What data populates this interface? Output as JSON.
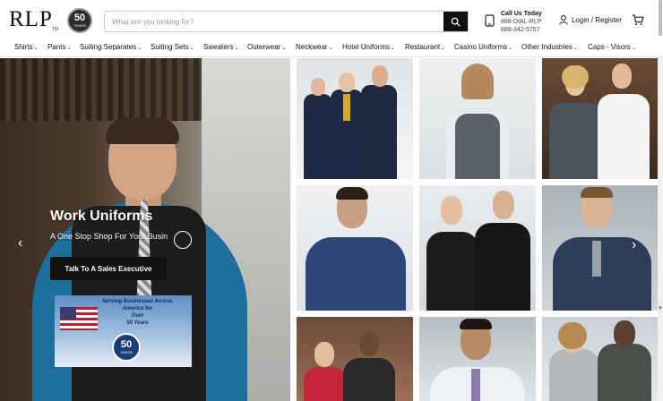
{
  "header": {
    "logo_text": "RLP",
    "logo_tm": "TM",
    "badge": {
      "number": "50",
      "sub": "YEARS"
    },
    "search": {
      "placeholder": "What are you looking for?",
      "value": ""
    },
    "call": {
      "title": "Call Us Today",
      "line1": "888-DIAL-RLP",
      "line2": "888-342-5757"
    },
    "login_label": "Login / Register",
    "icons": {
      "search": "search-icon",
      "phone": "phone-icon",
      "user": "user-icon",
      "cart": "cart-icon"
    }
  },
  "nav": {
    "items": [
      {
        "label": "Shirts"
      },
      {
        "label": "Pants"
      },
      {
        "label": "Suiting Separates"
      },
      {
        "label": "Suiting Sets"
      },
      {
        "label": "Sweaters"
      },
      {
        "label": "Outerwear"
      },
      {
        "label": "Neckwear"
      },
      {
        "label": "Hotel Uniforms"
      },
      {
        "label": "Restaurant"
      },
      {
        "label": "Casino Uniforms"
      },
      {
        "label": "Other Industries"
      },
      {
        "label": "Caps - Visors"
      }
    ]
  },
  "hero": {
    "title": "Work Uniforms",
    "subtitle": "A One Stop Shop For Your Busin",
    "button_label": "Talk To A Sales Executive",
    "prev_label": "‹",
    "next_label": "›",
    "promo": {
      "line1": "Serving Businesses Across",
      "line2": "America for",
      "line3": "Over",
      "line4": "50 Years",
      "seal_number": "50",
      "seal_sub": "YEARS"
    }
  },
  "colors": {
    "accent": "#111111",
    "shirt_blue": "#1f6f9e",
    "navy": "#1e2a44"
  }
}
